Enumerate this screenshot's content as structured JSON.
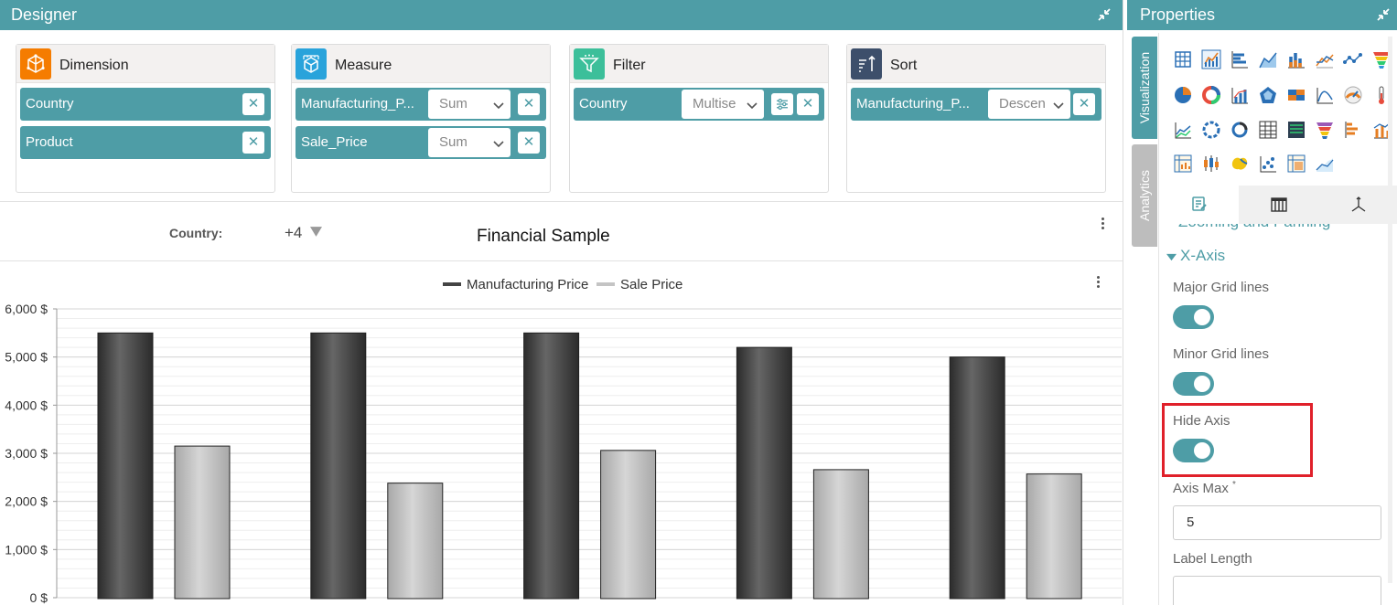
{
  "designer": {
    "title": "Designer",
    "cards": [
      {
        "title": "Dimension",
        "color": "#f57c00",
        "items": [
          {
            "label": "Country"
          },
          {
            "label": "Product"
          }
        ]
      },
      {
        "title": "Measure",
        "color": "#29a3db",
        "items": [
          {
            "label": "Manufacturing_P...",
            "agg": "Sum"
          },
          {
            "label": "Sale_Price",
            "agg": "Sum"
          }
        ]
      },
      {
        "title": "Filter",
        "color": "#3cbf9a",
        "items": [
          {
            "label": "Country",
            "agg": "Multise"
          }
        ]
      },
      {
        "title": "Sort",
        "color": "#3d4f6b",
        "items": [
          {
            "label": "Manufacturing_P...",
            "agg": "Descen"
          }
        ]
      }
    ],
    "filter_label": "Country:",
    "filter_value": "+4",
    "report_title": "Financial Sample"
  },
  "chart_data": {
    "type": "bar",
    "categories": [
      "",
      "",
      "",
      "",
      ""
    ],
    "series": [
      {
        "name": "Manufacturing Price",
        "values": [
          5500,
          5500,
          5500,
          5200,
          5000
        ],
        "color": "#444444"
      },
      {
        "name": "Sale Price",
        "values": [
          3150,
          2380,
          3060,
          2660,
          2570
        ],
        "color": "#c4c4c4"
      }
    ],
    "ylim": [
      0,
      6000
    ],
    "yticks": [
      "0 $",
      "1,000 $",
      "2,000 $",
      "3,000 $",
      "4,000 $",
      "5,000 $",
      "6,000 $"
    ],
    "legend": "top-center",
    "grid": true
  },
  "properties": {
    "title": "Properties",
    "tab_visualization": "Visualization",
    "tab_analytics": "Analytics",
    "section_partial": "Zooming and Panning",
    "section": "X-Axis",
    "major_grid": "Major Grid lines",
    "minor_grid": "Minor Grid lines",
    "hide_axis": "Hide Axis",
    "axis_max": "Axis Max",
    "axis_max_required": "*",
    "axis_max_value": "5",
    "label_length": "Label Length",
    "highlight_color": "#e0202a"
  }
}
